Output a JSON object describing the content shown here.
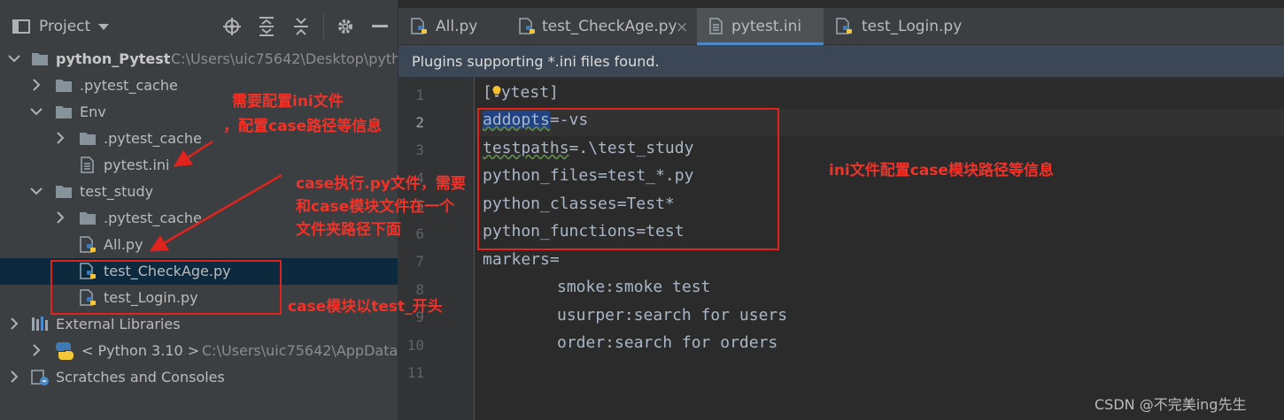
{
  "project_panel": {
    "title": "Project",
    "tree": [
      {
        "label": "python_Pytest",
        "path": "C:\\Users\\uic75642\\Desktop\\pyth",
        "icon": "folder-icon"
      },
      {
        "label": ".pytest_cache",
        "icon": "folder-icon"
      },
      {
        "label": "Env",
        "icon": "folder-icon"
      },
      {
        "label": ".pytest_cache",
        "icon": "folder-icon"
      },
      {
        "label": "pytest.ini",
        "icon": "ini-file-icon"
      },
      {
        "label": "test_study",
        "icon": "folder-icon"
      },
      {
        "label": ".pytest_cache",
        "icon": "folder-icon"
      },
      {
        "label": "All.py",
        "icon": "python-file-icon"
      },
      {
        "label": "test_CheckAge.py",
        "icon": "python-file-icon"
      },
      {
        "label": "test_Login.py",
        "icon": "python-file-icon"
      },
      {
        "label": "External Libraries",
        "icon": "libraries-icon"
      },
      {
        "label": "< Python 3.10 >",
        "path": "C:\\Users\\uic75642\\AppData",
        "icon": "python-icon"
      },
      {
        "label": "Scratches and Consoles",
        "icon": "scratches-icon"
      }
    ]
  },
  "editor": {
    "tabs": [
      {
        "label": "All.py",
        "icon": "python-file-icon",
        "active": false
      },
      {
        "label": "test_CheckAge.py",
        "icon": "python-file-icon",
        "active": false,
        "close": "×"
      },
      {
        "label": "pytest.ini",
        "icon": "ini-file-icon",
        "active": true
      },
      {
        "label": "test_Login.py",
        "icon": "python-file-icon",
        "active": false
      }
    ],
    "banner": "Plugins supporting *.ini files found.",
    "line_numbers": [
      "1",
      "2",
      "3",
      "4",
      "5",
      "6",
      "7",
      "8",
      "9",
      "10",
      "11"
    ],
    "code": {
      "line1_open": "[",
      "line1_rest": "ytest]",
      "line2_key": "addopts",
      "line2_rest": "=-vs",
      "line3_key": "testpaths",
      "line3_rest": "=.\\test_study",
      "line4": "python_files=test_*.py",
      "line5": "python_classes=Test*",
      "line6": "python_functions=test",
      "line7": "markers=",
      "line8": "smoke:smoke test",
      "line9": "usurper:search for users",
      "line10": "order:search for orders"
    }
  },
  "annotations": {
    "ini_note_1": "需要配置ini文件",
    "ini_note_2": "，配置case路径等信息",
    "case_note_1": "case执行.py文件，需要",
    "case_note_2": "和case模块文件在一个",
    "case_note_3": "文件夹路径下面",
    "prefix_note": "case模块以test_开头",
    "config_note": "ini文件配置case模块路径等信息"
  },
  "colors": {
    "annotation": "#e0231c",
    "selection": "#0d293e",
    "accent": "#4a88c7"
  },
  "watermark": "CSDN @不完美ing先生"
}
